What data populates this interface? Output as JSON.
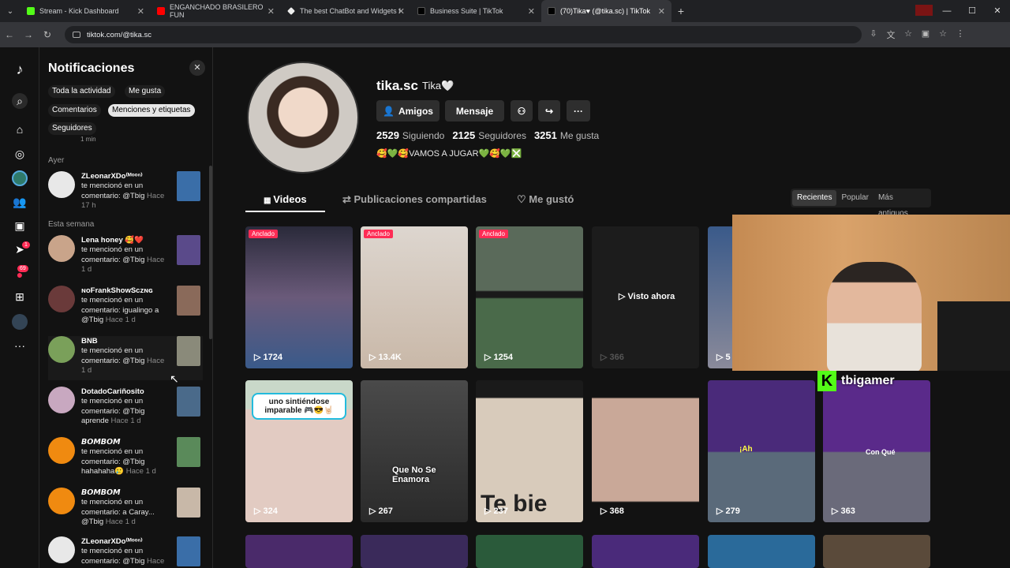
{
  "browser": {
    "tabs": [
      {
        "title": "Stream - Kick Dashboard",
        "color": "#53fc18"
      },
      {
        "title": "ENGANCHADO BRASILERO FUN",
        "color": "#ff0000"
      },
      {
        "title": "The best ChatBot and Widgets f",
        "color": "#ffffff"
      },
      {
        "title": "Business Suite | TikTok",
        "color": "#000000"
      },
      {
        "title": "(70)Tika♥ (@tika.sc) | TikTok",
        "color": "#000000"
      }
    ],
    "url": "tiktok.com/@tika.sc"
  },
  "rail": {
    "badge_inbox": "1",
    "badge_messages": "69"
  },
  "notifications": {
    "title": "Notificaciones",
    "filters": [
      "Toda la actividad",
      "Me gusta",
      "Comentarios",
      "Menciones y etiquetas",
      "Seguidores"
    ],
    "time_clip": "1 min",
    "section_yesterday": "Ayer",
    "section_week": "Esta semana",
    "items": [
      {
        "name": "ZLeonarXDo⁽ᴹᵒᵒⁿ⁾",
        "text": "te mencionó en un comentario: @Tbig",
        "time": "Hace 17 h",
        "avatar": "#e8e8e8",
        "thumb": "#3a6ea8"
      },
      {
        "name": "Lena honey 🥰❤️",
        "text": "te mencionó en un comentario: @Tbig",
        "time": "Hace 1 d",
        "avatar": "#c9a48a",
        "thumb": "#5a4a8a"
      },
      {
        "name": "ɴᴏFrankShowSᴄᴢɴɢ",
        "text": "te mencionó en un comentario: igualingo a @Tbig",
        "time": "Hace 1 d",
        "avatar": "#6a3a3a",
        "thumb": "#8a6a5a"
      },
      {
        "name": "BNB",
        "text": "te mencionó en un comentario: @Tbig",
        "time": "Hace 1 d",
        "avatar": "#7aa05a",
        "thumb": "#8a8a7a"
      },
      {
        "name": "DotadoCariñosito",
        "text": "te mencionó en un comentario: @Tbig aprende",
        "time": "Hace 1 d",
        "avatar": "#c8a8c0",
        "thumb": "#4a6a8a"
      },
      {
        "name": "𝘽𝙊𝙈𝘽𝙊𝙈",
        "text": "te mencionó en un comentario: @Tbig hahahaha🥲",
        "time": "Hace 1 d",
        "avatar": "#f08a10",
        "thumb": "#5a8a5a"
      },
      {
        "name": "𝘽𝙊𝙈𝘽𝙊𝙈",
        "text": "te mencionó en un comentario: a Caray... @Tbig",
        "time": "Hace 1 d",
        "avatar": "#f08a10",
        "thumb": "#c8b8a8"
      },
      {
        "name": "ZLeonarXDo⁽ᴹᵒᵒⁿ⁾",
        "text": "te mencionó en un comentario: @Tbig",
        "time": "Hace",
        "avatar": "#e8e8e8",
        "thumb": "#3a6ea8"
      }
    ]
  },
  "profile": {
    "username": "tika.sc",
    "nickname": "Tika🤍",
    "friends_label": "Amigos",
    "message_label": "Mensaje",
    "following": "2529",
    "following_label": "Siguiendo",
    "followers": "2125",
    "followers_label": "Seguidores",
    "likes": "3251",
    "likes_label": "Me gusta",
    "bio": "🥰💚🥰VAMOS A JUGAR💚🥰💚❎"
  },
  "tabs": {
    "videos": "Videos",
    "reposts": "Publicaciones compartidas",
    "liked": "Me gustó"
  },
  "sort": [
    "Recientes",
    "Popular",
    "Más antiguos"
  ],
  "videos_row1": [
    {
      "views": "1724",
      "pinned": "Anclado",
      "bg": "#3a4a6a"
    },
    {
      "views": "13.4K",
      "pinned": "Anclado",
      "bg": "#cfc6bd"
    },
    {
      "views": "1254",
      "pinned": "Anclado",
      "bg": "#3a5a4a"
    },
    {
      "views": "366",
      "pinned": "",
      "bg": "#1c1c1c",
      "overlay": "Visto ahora"
    },
    {
      "views": "5",
      "pinned": "",
      "bg": "#2a3a5a"
    }
  ],
  "videos_row2": [
    {
      "views": "324",
      "bg": "#d9c8c0",
      "caption": "uno sintiéndose imparable 🎮😎🤘🏻"
    },
    {
      "views": "267",
      "bg": "#3a3a3a",
      "caption": "Que No Se Enamora"
    },
    {
      "views": "237",
      "bg": "#cbbfb0",
      "caption": "Te bie"
    },
    {
      "views": "368",
      "bg": "#b89a88",
      "caption": ""
    },
    {
      "views": "279",
      "bg": "#4a2a6a",
      "caption": "¡Ah"
    },
    {
      "views": "363",
      "bg": "#5a2a7a",
      "caption": "Con Qué"
    }
  ],
  "stream": {
    "channel": "tbigamer"
  }
}
